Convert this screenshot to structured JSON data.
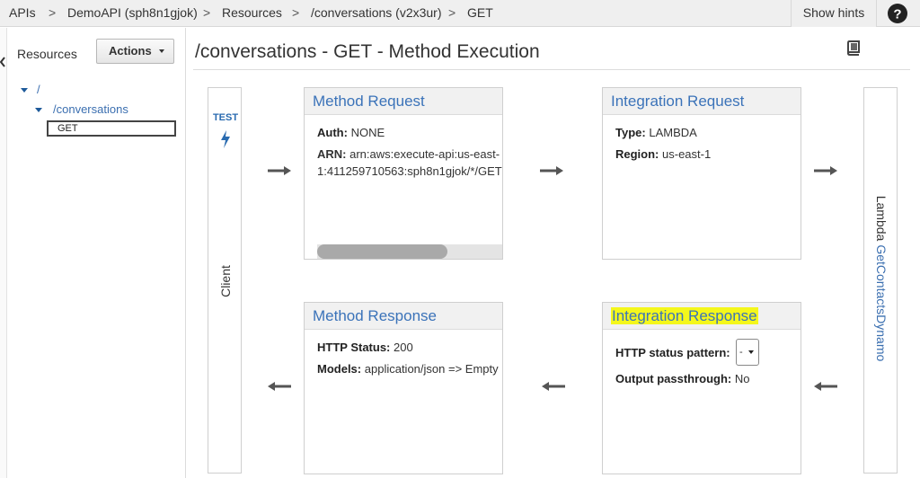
{
  "breadcrumb": [
    "APIs",
    "DemoAPI (sph8n1gjok)",
    "Resources",
    "/conversations (v2x3ur)",
    "GET"
  ],
  "breadcrumb_separator": ">",
  "header": {
    "show_hints": "Show hints",
    "help_icon": "question-circle-icon"
  },
  "sidebar": {
    "title": "Resources",
    "actions_label": "Actions",
    "tree": {
      "root": "/",
      "child": "/conversations",
      "method": "GET"
    }
  },
  "page": {
    "title": "/conversations - GET - Method Execution",
    "doc_icon": "book-icon"
  },
  "client": {
    "test_label": "TEST",
    "label": "Client"
  },
  "lambda": {
    "label": "Lambda",
    "function": "GetContactsDynamo"
  },
  "method_request": {
    "title": "Method Request",
    "auth_label": "Auth:",
    "auth_value": "NONE",
    "arn_label": "ARN:",
    "arn_value": "arn:aws:execute-api:us-east-1:411259710563:sph8n1gjok/*/GET"
  },
  "integration_request": {
    "title": "Integration Request",
    "type_label": "Type:",
    "type_value": "LAMBDA",
    "region_label": "Region:",
    "region_value": "us-east-1"
  },
  "method_response": {
    "title": "Method Response",
    "status_label": "HTTP Status:",
    "status_value": "200",
    "models_label": "Models:",
    "models_value": "application/json => Empty"
  },
  "integration_response": {
    "title": "Integration Response",
    "pattern_label": "HTTP status pattern:",
    "pattern_value": "-",
    "passthrough_label": "Output passthrough:",
    "passthrough_value": "No"
  },
  "colors": {
    "link": "#3b73b9",
    "highlight": "#f4f71b",
    "test_blue": "#2a6bb0"
  }
}
